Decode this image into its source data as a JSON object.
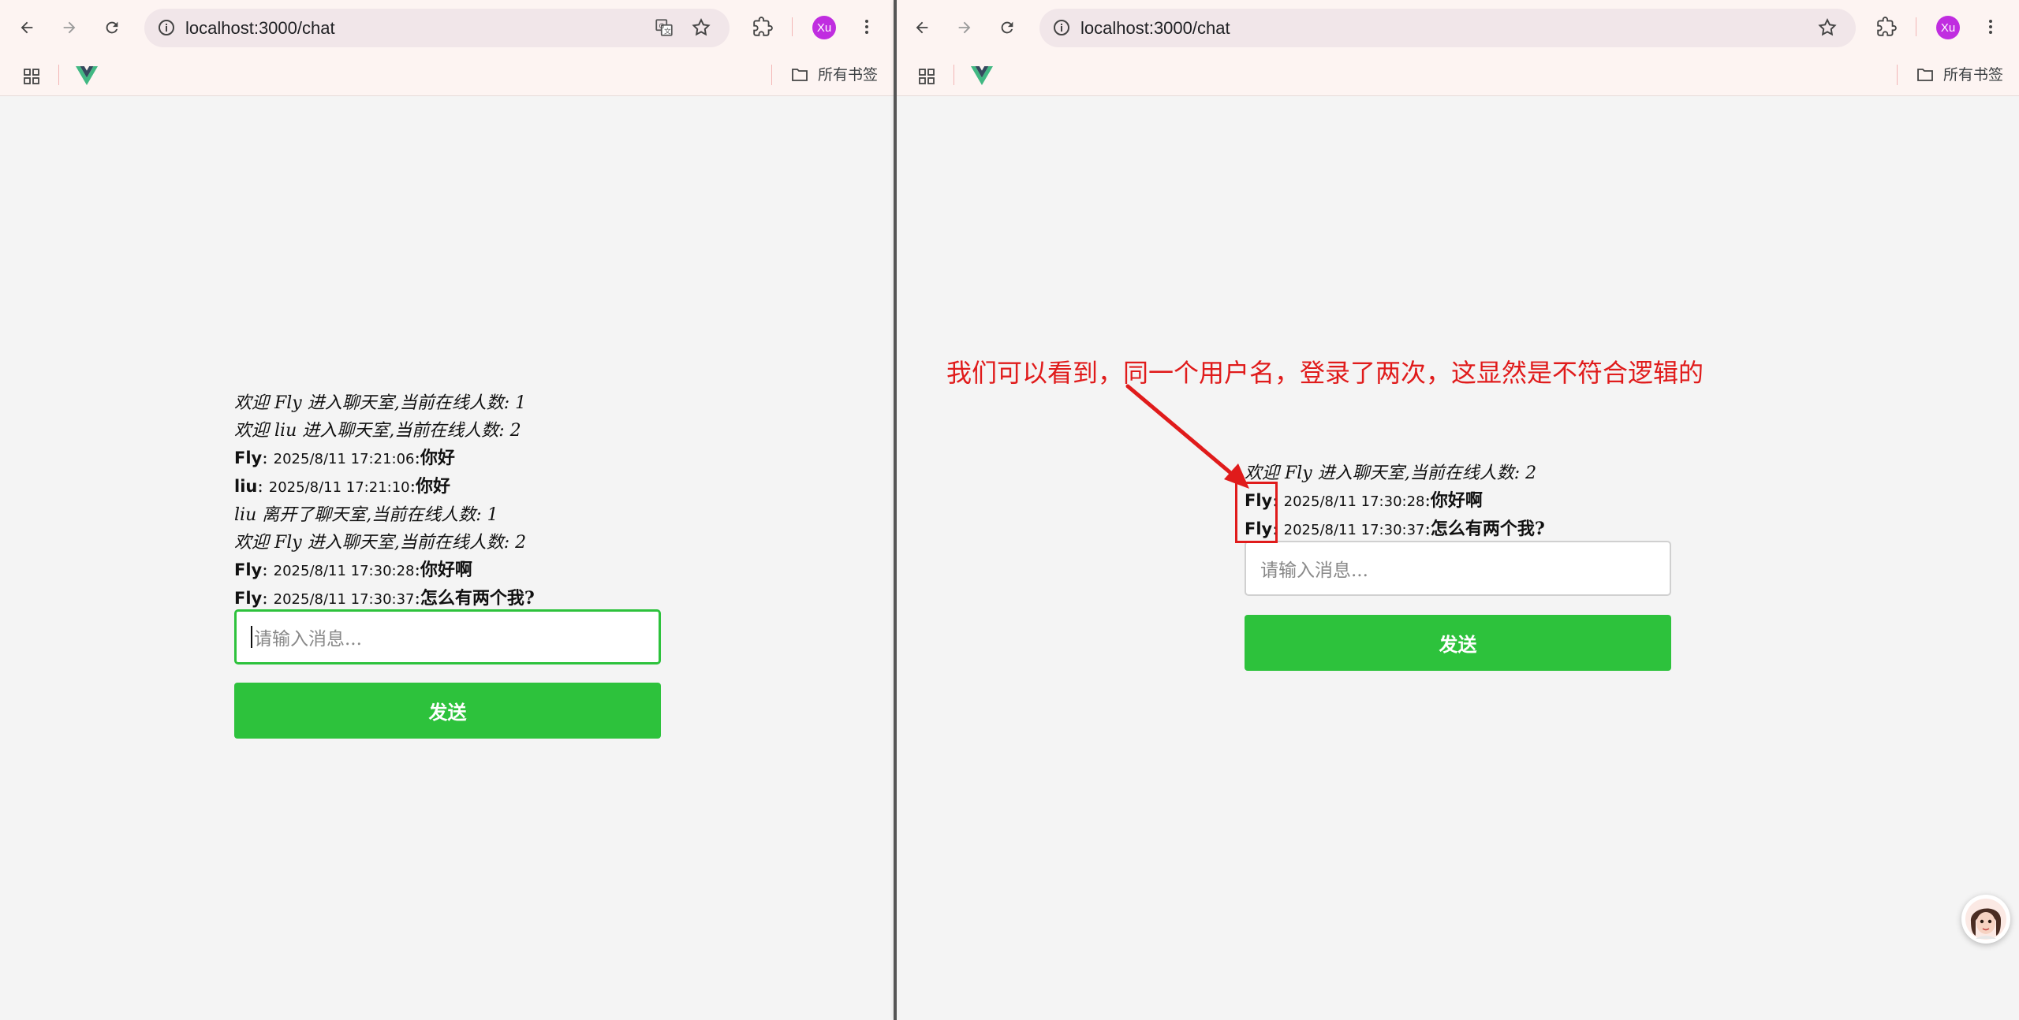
{
  "left": {
    "url": "localhost:3000/chat",
    "avatar": "Xu",
    "bookmarks_label": "所有书签",
    "messages": [
      {
        "type": "system",
        "text": "欢迎 Fly 进入聊天室,当前在线人数: 1"
      },
      {
        "type": "system",
        "text": "欢迎 liu 进入聊天室,当前在线人数: 2"
      },
      {
        "type": "user",
        "user": "Fly",
        "time": "2025/8/11 17:21:06",
        "text": "你好"
      },
      {
        "type": "user",
        "user": "liu",
        "time": "2025/8/11 17:21:10",
        "text": "你好"
      },
      {
        "type": "system",
        "text": "liu 离开了聊天室,当前在线人数: 1"
      },
      {
        "type": "system",
        "text": "欢迎 Fly 进入聊天室,当前在线人数: 2"
      },
      {
        "type": "user",
        "user": "Fly",
        "time": "2025/8/11 17:30:28",
        "text": "你好啊"
      },
      {
        "type": "user",
        "user": "Fly",
        "time": "2025/8/11 17:30:37",
        "text": "怎么有两个我?"
      }
    ],
    "input_placeholder": "请输入消息...",
    "send_label": "发送"
  },
  "right": {
    "url": "localhost:3000/chat",
    "avatar": "Xu",
    "bookmarks_label": "所有书签",
    "messages": [
      {
        "type": "system",
        "text": "欢迎 Fly 进入聊天室,当前在线人数: 2"
      },
      {
        "type": "user",
        "user": "Fly",
        "time": "2025/8/11 17:30:28",
        "text": "你好啊"
      },
      {
        "type": "user",
        "user": "Fly",
        "time": "2025/8/11 17:30:37",
        "text": "怎么有两个我?"
      }
    ],
    "input_placeholder": "请输入消息...",
    "send_label": "发送"
  },
  "annotation": "我们可以看到，同一个用户名，登录了两次，这显然是不符合逻辑的",
  "colors": {
    "send_button": "#2dc23c",
    "annotation": "#e01b1b",
    "avatar": "#c02de0",
    "focus_border": "#2dc23c"
  },
  "icons": [
    "back-icon",
    "forward-icon",
    "reload-icon",
    "info-icon",
    "translate-icon",
    "star-icon",
    "extensions-icon",
    "menu-icon",
    "apps-icon",
    "vue-logo-icon",
    "folder-icon",
    "assistant-avatar-icon"
  ]
}
